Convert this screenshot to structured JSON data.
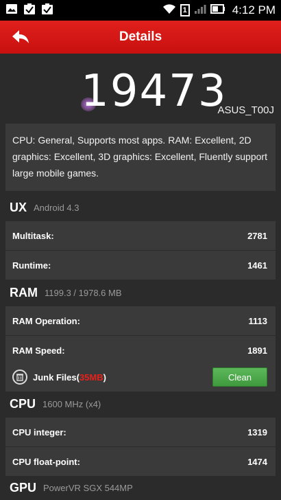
{
  "status_bar": {
    "time": "4:12 PM",
    "sim_indicator": "1"
  },
  "header": {
    "title": "Details"
  },
  "score": {
    "value": "19473",
    "device": "ASUS_T00J"
  },
  "description": "CPU: General, Supports most apps. RAM: Excellent, 2D graphics: Excellent, 3D graphics: Excellent, Fluently support large mobile games.",
  "ux": {
    "name": "UX",
    "sub": "Android 4.3",
    "rows": [
      {
        "label": "Multitask:",
        "value": "2781"
      },
      {
        "label": "Runtime:",
        "value": "1461"
      }
    ]
  },
  "ram": {
    "name": "RAM",
    "sub": "1199.3 / 1978.6 MB",
    "rows": [
      {
        "label": "RAM Operation:",
        "value": "1113"
      },
      {
        "label": "RAM Speed:",
        "value": "1891"
      }
    ],
    "junk": {
      "label_prefix": "Junk Files(",
      "size": "35MB",
      "label_suffix": ")",
      "button": "Clean"
    }
  },
  "cpu": {
    "name": "CPU",
    "sub": "1600 MHz (x4)",
    "rows": [
      {
        "label": "CPU integer:",
        "value": "1319"
      },
      {
        "label": "CPU float-point:",
        "value": "1474"
      }
    ]
  },
  "gpu": {
    "name": "GPU",
    "sub": "PowerVR SGX 544MP"
  },
  "colors": {
    "header": "#d4151a",
    "accent_red": "#e8201a",
    "clean_green": "#4aa848"
  }
}
